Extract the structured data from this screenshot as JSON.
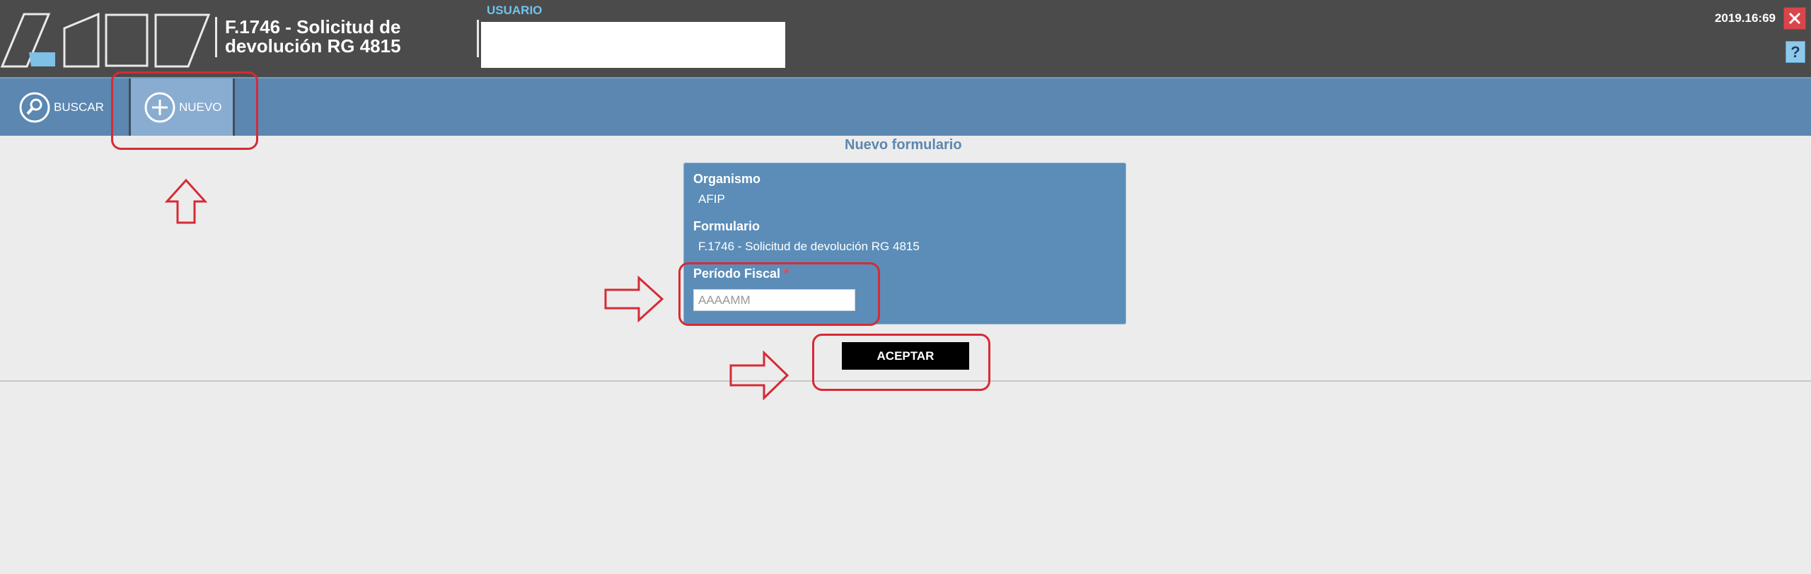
{
  "header": {
    "logo_text": "AFIP",
    "app_title_line1": "F.1746 - Solicitud de",
    "app_title_line2": "devolución RG 4815",
    "user_label": "USUARIO",
    "clock": "2019.16:69",
    "help_label": "?"
  },
  "toolbar": {
    "items": [
      {
        "label": "BUSCAR",
        "icon": "search-icon"
      },
      {
        "label": "NUEVO",
        "icon": "plus-circle-icon"
      }
    ]
  },
  "form": {
    "title": "Nuevo formulario",
    "organismo_label": "Organismo",
    "organismo_value": "AFIP",
    "formulario_label": "Formulario",
    "formulario_value": "F.1746 - Solicitud de devolución RG 4815",
    "periodo_label": "Período Fiscal",
    "required_mark": "*",
    "periodo_placeholder": "AAAAMM",
    "accept_label": "ACEPTAR"
  },
  "colors": {
    "header_bg": "#4b4b4b",
    "toolbar_bg": "#5b87b1",
    "panel_bg": "#5b8db8",
    "annotation_red": "#d52b36",
    "accept_bg": "#000000"
  }
}
